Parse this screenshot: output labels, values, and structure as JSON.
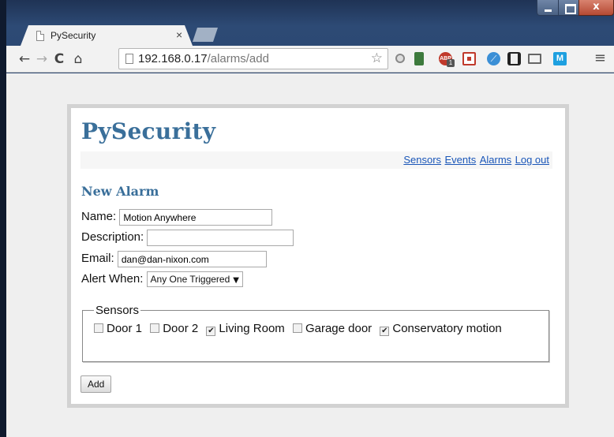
{
  "browser": {
    "tab_title": "PySecurity",
    "tab_close": "×",
    "url_host": "192.168.0.17",
    "url_path": "/alarms/add",
    "star": "☆",
    "menu": "≡",
    "window_close": "x",
    "extensions": [
      "search-extension",
      "green-extension",
      "adblock-plus",
      "puzzle-extension",
      "blue-extension",
      "film-extension",
      "cast",
      "m-extension"
    ],
    "abp_label": "ABP",
    "abp_count": "1",
    "m_ext_label": "M"
  },
  "site": {
    "title": "PySecurity",
    "nav": {
      "sensors": "Sensors",
      "events": "Events",
      "alarms": "Alarms",
      "logout": "Log out"
    }
  },
  "form": {
    "heading": "New Alarm",
    "name_label": "Name:",
    "name_value": "Motion Anywhere",
    "description_label": "Description:",
    "description_value": "",
    "email_label": "Email:",
    "email_value": "dan@dan-nixon.com",
    "alert_label": "Alert When:",
    "alert_value": "Any One Triggered",
    "sensors_legend": "Sensors",
    "sensors": [
      {
        "label": "Door 1",
        "checked": false
      },
      {
        "label": "Door 2",
        "checked": false
      },
      {
        "label": "Living Room",
        "checked": true
      },
      {
        "label": "Garage door",
        "checked": false
      },
      {
        "label": "Conservatory motion",
        "checked": true
      }
    ],
    "add_button": "Add"
  },
  "colors": {
    "title": "#3a6f9a",
    "link": "#1a56b8",
    "close_button": "#b64a33"
  }
}
